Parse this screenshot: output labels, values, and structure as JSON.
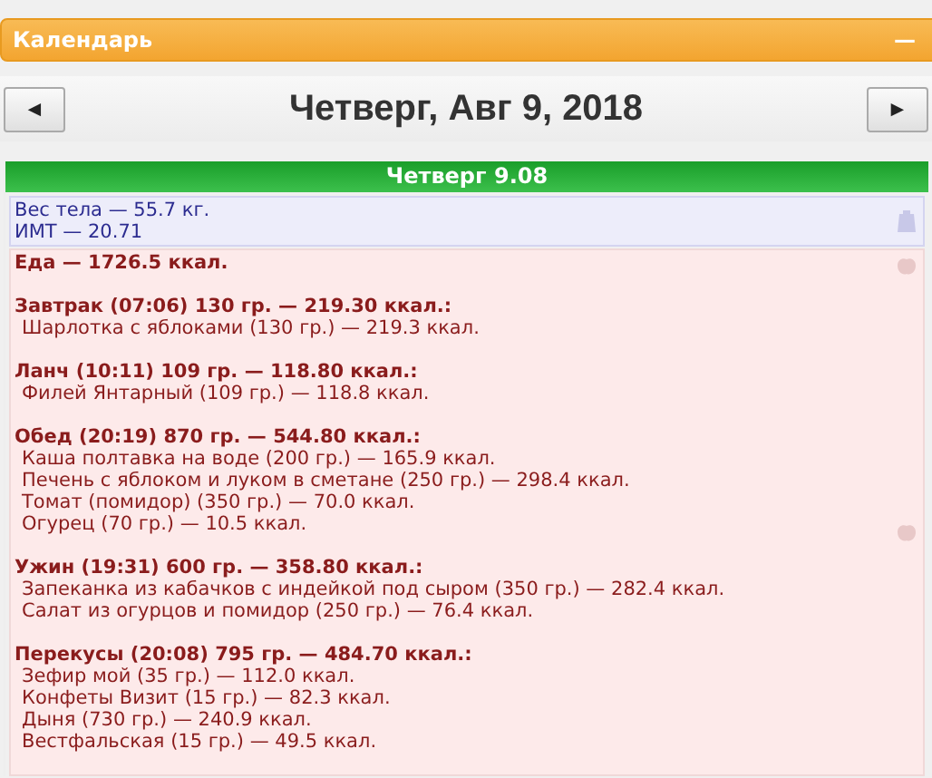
{
  "panel": {
    "title": "Календарь",
    "collapse_glyph": "—"
  },
  "nav": {
    "prev": "◄",
    "title": "Четверг, Авг 9, 2018",
    "next": "►"
  },
  "day": {
    "heading": "Четверг 9.08",
    "weight": [
      "Вес тела — 55.7 кг.",
      "ИМТ — 20.71"
    ],
    "food": {
      "total": "Еда — 1726.5 ккал.",
      "meals": [
        {
          "title": "Завтрак (07:06) 130 гр. — 219.30 ккал.:",
          "items": [
            "Шарлотка с яблоками (130 гр.) — 219.3 ккал."
          ]
        },
        {
          "title": "Ланч (10:11) 109 гр. — 118.80 ккал.:",
          "items": [
            "Филей Янтарный (109 гр.) — 118.8 ккал."
          ]
        },
        {
          "title": "Обед (20:19) 870 гр. — 544.80 ккал.:",
          "items": [
            "Каша полтавка на воде (200 гр.) — 165.9 ккал.",
            "Печень с яблоком и луком в сметане (250 гр.) — 298.4 ккал.",
            "Томат (помидор) (350 гр.) — 70.0 ккал.",
            "Огурец (70 гр.) — 10.5 ккал."
          ]
        },
        {
          "title": "Ужин (19:31) 600 гр. — 358.80 ккал.:",
          "items": [
            "Запеканка из кабачков с индейкой под сыром (350 гр.) — 282.4 ккал.",
            "Салат из огурцов и помидор (250 гр.) — 76.4 ккал."
          ]
        },
        {
          "title": "Перекусы (20:08) 795 гр. — 484.70 ккал.:",
          "items": [
            "Зефир мой (35 гр.) — 112.0 ккал.",
            "Конфеты Визит (15 гр.) — 82.3 ккал.",
            "Дыня (730 гр.) — 240.9 ккал.",
            "Вестфальская (15 гр.) — 49.5 ккал."
          ]
        }
      ]
    }
  }
}
